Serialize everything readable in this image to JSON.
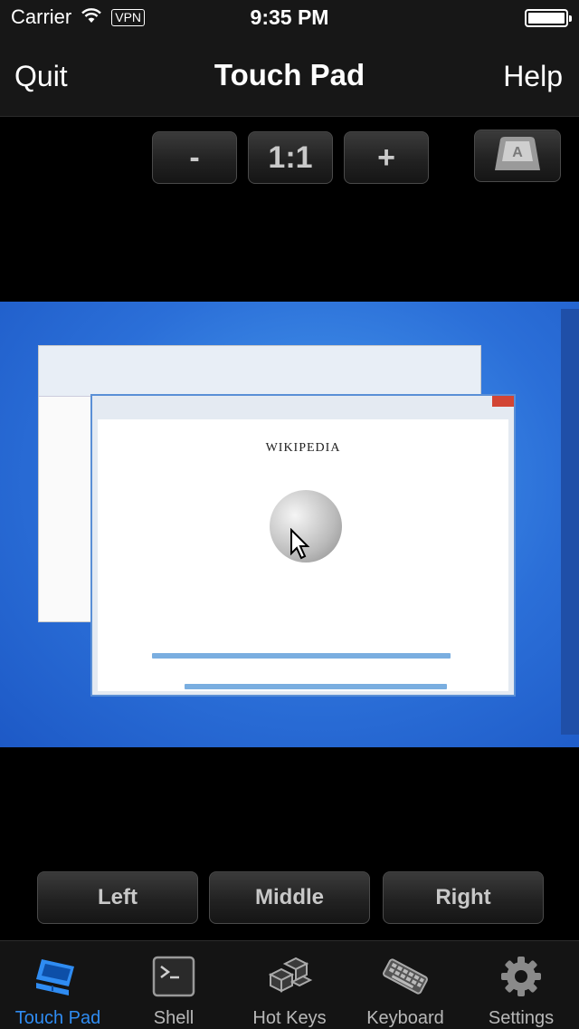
{
  "status_bar": {
    "carrier": "Carrier",
    "vpn": "VPN",
    "time": "9:35 PM",
    "battery_level": 1.0
  },
  "nav": {
    "left": "Quit",
    "title": "Touch Pad",
    "right": "Help"
  },
  "zoom": {
    "minus": "-",
    "reset": "1:1",
    "plus": "+",
    "keyboard_icon": "keycap-icon"
  },
  "remote_screen": {
    "page_heading": "WIKIPEDIA"
  },
  "mouse_buttons": {
    "left": "Left",
    "middle": "Middle",
    "right": "Right"
  },
  "tabs": [
    {
      "label": "Touch Pad",
      "icon": "touchpad-icon",
      "active": true
    },
    {
      "label": "Shell",
      "icon": "terminal-icon",
      "active": false
    },
    {
      "label": "Hot Keys",
      "icon": "hotkeys-icon",
      "active": false
    },
    {
      "label": "Keyboard",
      "icon": "keyboard-icon",
      "active": false
    },
    {
      "label": "Settings",
      "icon": "gear-icon",
      "active": false
    }
  ],
  "colors": {
    "accent": "#2f8cf2",
    "bar_background": "#171717"
  }
}
